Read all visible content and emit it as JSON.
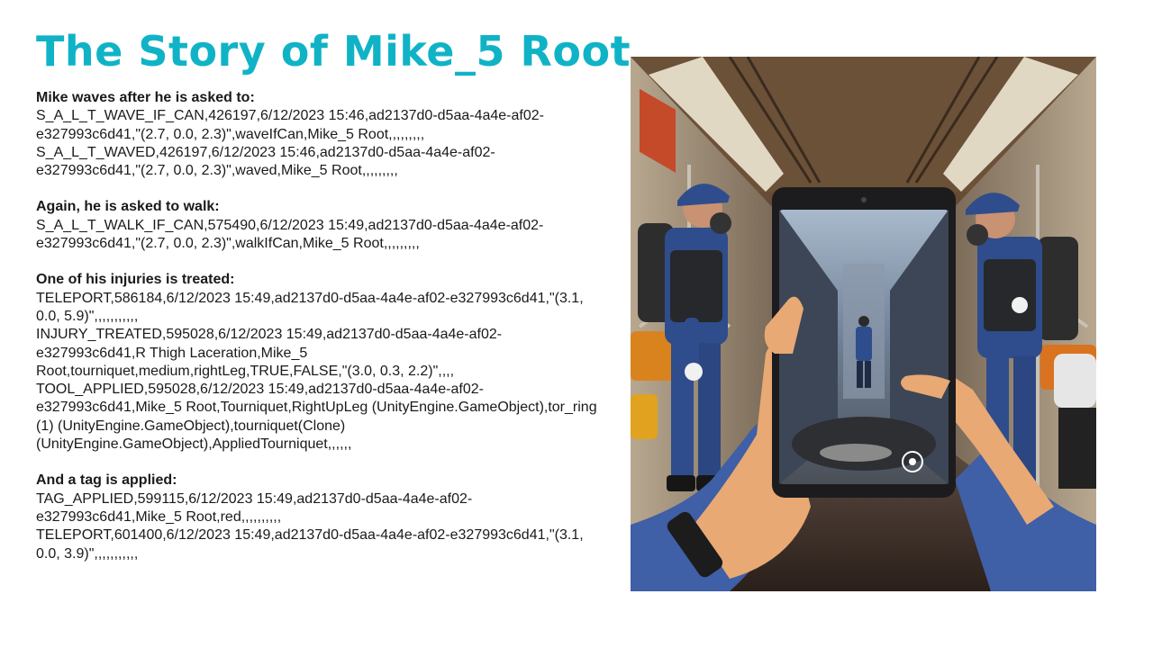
{
  "title": "The Story of Mike_5 Root",
  "sections": [
    {
      "heading": "Mike waves after he is asked to:",
      "lines": [
        "S_A_L_T_WAVE_IF_CAN,426197,6/12/2023 15:46,ad2137d0-d5aa-4a4e-af02-e327993c6d41,\"(2.7, 0.0, 2.3)\",waveIfCan,Mike_5 Root,,,,,,,,,",
        "S_A_L_T_WAVED,426197,6/12/2023 15:46,ad2137d0-d5aa-4a4e-af02-e327993c6d41,\"(2.7, 0.0, 2.3)\",waved,Mike_5 Root,,,,,,,,,"
      ]
    },
    {
      "heading": "Again, he is asked to walk:",
      "lines": [
        "S_A_L_T_WALK_IF_CAN,575490,6/12/2023 15:49,ad2137d0-d5aa-4a4e-af02-e327993c6d41,\"(2.7, 0.0, 2.3)\",walkIfCan,Mike_5 Root,,,,,,,,,"
      ]
    },
    {
      "heading": "One of his injuries is treated:",
      "lines": [
        "TELEPORT,586184,6/12/2023 15:49,ad2137d0-d5aa-4a4e-af02-e327993c6d41,\"(3.1, 0.0, 5.9)\",,,,,,,,,,,",
        "INJURY_TREATED,595028,6/12/2023 15:49,ad2137d0-d5aa-4a4e-af02-e327993c6d41,R Thigh Laceration,Mike_5 Root,tourniquet,medium,rightLeg,TRUE,FALSE,\"(3.0, 0.3, 2.2)\",,,,",
        "TOOL_APPLIED,595028,6/12/2023 15:49,ad2137d0-d5aa-4a4e-af02-e327993c6d41,Mike_5 Root,Tourniquet,RightUpLeg (UnityEngine.GameObject),tor_ring (1) (UnityEngine.GameObject),tourniquet(Clone) (UnityEngine.GameObject),AppliedTourniquet,,,,,,"
      ]
    },
    {
      "heading": "And a tag is applied:",
      "lines": [
        "TAG_APPLIED,599115,6/12/2023 15:49,ad2137d0-d5aa-4a4e-af02-e327993c6d41,Mike_5 Root,red,,,,,,,,,,",
        "TELEPORT,601400,6/12/2023 15:49,ad2137d0-d5aa-4a4e-af02-e327993c6d41,\"(3.1, 0.0, 3.9)\",,,,,,,,,,,"
      ]
    }
  ],
  "colors": {
    "title": "#10b3c6",
    "text": "#1a1a1a",
    "uniform": "#2f4d8c",
    "seat_orange": "#d9831f",
    "hand": "#e8a974"
  }
}
